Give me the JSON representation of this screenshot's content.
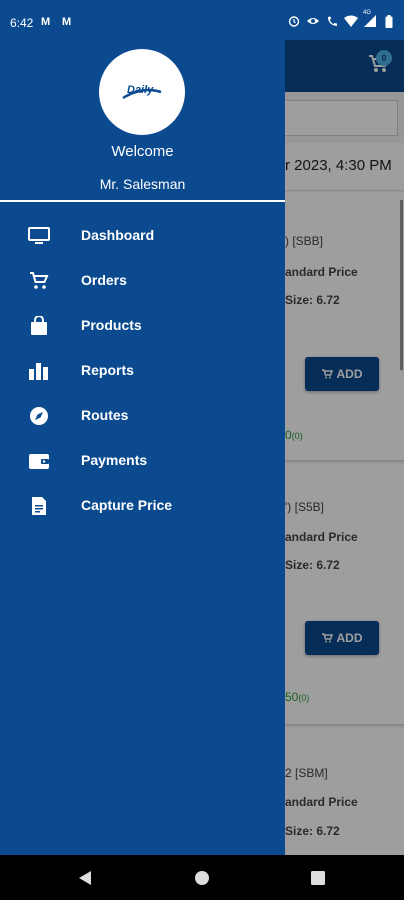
{
  "status_bar": {
    "time": "6:42",
    "network": "4G"
  },
  "app_bg": {
    "cart_count": "0",
    "date_text": "r 2023, 4:30 PM",
    "cards": [
      {
        "code_line": ") [SBB]",
        "price_line": "andard Price",
        "size_line": "Size: 6.72",
        "add_label": "ADD",
        "qty_main": "0",
        "qty_small": "(0)"
      },
      {
        "code_line": "') [S5B]",
        "price_line": "andard Price",
        "size_line": "Size: 6.72",
        "add_label": "ADD",
        "qty_main": "50",
        "qty_small": "(0)"
      },
      {
        "code_line": "2 [SBM]",
        "price_line": "andard Price",
        "size_line": "Size: 6.72"
      }
    ]
  },
  "drawer": {
    "logo_text": "Daily",
    "welcome": "Welcome",
    "user_name": "Mr. Salesman",
    "menu": [
      {
        "label": "Dashboard",
        "icon": "monitor-icon"
      },
      {
        "label": "Orders",
        "icon": "cart-icon"
      },
      {
        "label": "Products",
        "icon": "bag-icon"
      },
      {
        "label": "Reports",
        "icon": "bar-chart-icon"
      },
      {
        "label": "Routes",
        "icon": "compass-icon"
      },
      {
        "label": "Payments",
        "icon": "wallet-icon"
      },
      {
        "label": "Capture Price",
        "icon": "document-icon"
      }
    ]
  },
  "colors": {
    "primary": "#0b4a8f",
    "badge": "#4fb3e6",
    "qty_green": "#2e9b3a",
    "scrim": "rgba(0,0,0,0.38)"
  }
}
